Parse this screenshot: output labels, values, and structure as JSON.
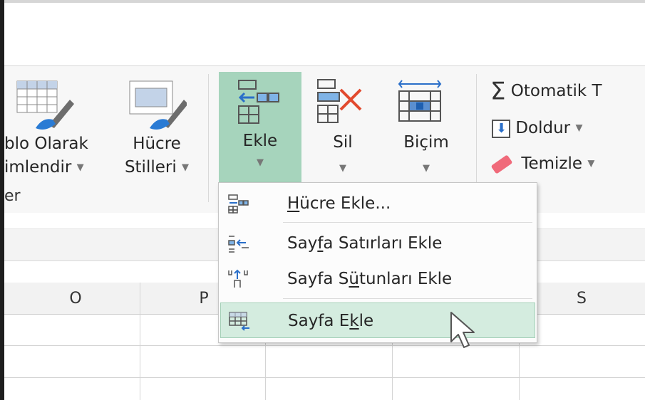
{
  "ribbon": {
    "format_as_table": {
      "line1": "blo Olarak",
      "line2": "imlendir",
      "icon": "table-format-icon"
    },
    "cell_styles": {
      "line1": "Hücre",
      "line2": "Stilleri",
      "icon": "cell-styles-icon"
    },
    "group_label": "er",
    "insert": {
      "label": "Ekle",
      "icon": "insert-cells-icon"
    },
    "delete": {
      "label": "Sil",
      "icon": "delete-cells-icon"
    },
    "format": {
      "label": "Biçim",
      "icon": "format-cells-icon"
    },
    "autosum": {
      "label": "Otomatik T",
      "icon": "sigma-icon"
    },
    "fill": {
      "label": "Doldur",
      "icon": "fill-down-icon"
    },
    "clear": {
      "label": "Temizle",
      "icon": "eraser-icon"
    },
    "colors": {
      "insert_highlight": "#a6d4bc",
      "accent": "#217346"
    }
  },
  "menu": {
    "items": [
      {
        "pre": "",
        "ul": "H",
        "post": "ücre Ekle...",
        "icon": "insert-cells-icon"
      },
      {
        "pre": "Say",
        "ul": "f",
        "post": "a Satırları Ekle",
        "icon": "insert-rows-icon"
      },
      {
        "pre": "Sayfa S",
        "ul": "ü",
        "post": "tunları Ekle",
        "icon": "insert-columns-icon"
      },
      {
        "pre": "Sayfa E",
        "ul": "k",
        "post": "le",
        "icon": "insert-sheet-icon"
      }
    ],
    "selected_index": 3
  },
  "columns": [
    "O",
    "P",
    "",
    "",
    "S"
  ]
}
